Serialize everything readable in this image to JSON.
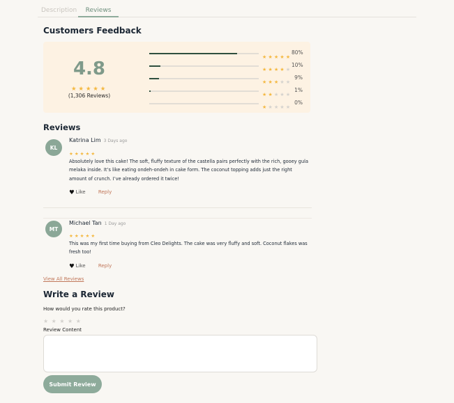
{
  "tabs": [
    {
      "label": "Description",
      "active": false
    },
    {
      "label": "Reviews",
      "active": true
    }
  ],
  "feedback": {
    "heading": "Customers Feedback",
    "score": "4.8",
    "score_stars": 5,
    "count_text": "(1,306 Reviews)",
    "breakdown": [
      {
        "stars": 5,
        "percent": 80,
        "label": "80%"
      },
      {
        "stars": 4,
        "percent": 10,
        "label": "10%"
      },
      {
        "stars": 3,
        "percent": 9,
        "label": "9%"
      },
      {
        "stars": 2,
        "percent": 1,
        "label": "1%"
      },
      {
        "stars": 1,
        "percent": 0,
        "label": "0%"
      }
    ]
  },
  "reviews_heading": "Reviews",
  "reviews": [
    {
      "initials": "KL",
      "name": "Katrina Lim",
      "date": "3 Days ago",
      "rating": 5,
      "text": "Absolutely love this cake! The soft, fluffy texture of the castella pairs perfectly with the rich, gooey gula melaka inside. It’s like eating ondeh-ondeh in cake form. The coconut topping adds just the right amount of crunch. I’ve already ordered it twice!",
      "like_label": "Like",
      "reply_label": "Reply"
    },
    {
      "initials": "MT",
      "name": "Michael Tan",
      "date": "1 Day ago",
      "rating": 5,
      "text": "This was my first time buying from Cleo Delights. The cake was very fluffy and soft. Coconut flakes was fresh too!",
      "like_label": "Like",
      "reply_label": "Reply"
    }
  ],
  "view_all_label": "View All Reviews",
  "write": {
    "heading": "Write a Review",
    "rate_question": "How would you rate this product?",
    "rate_value": 0,
    "content_label": "Review Content",
    "content_value": "",
    "submit_label": "Submit Review"
  },
  "colors": {
    "accent": "#8eab9b",
    "star": "#f4b840",
    "star_off": "#d4d2ce",
    "bar_fill": "#2f4f3e",
    "summary_bg": "#fdf2e3",
    "link": "#c1775a"
  },
  "icons": {
    "star": "star-icon",
    "like": "heart-icon"
  }
}
